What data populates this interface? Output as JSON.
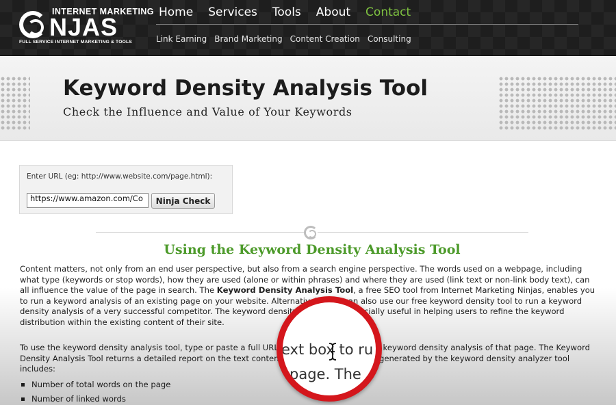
{
  "header": {
    "logo": {
      "top_text": "INTERNET MARKETING",
      "main_text": "NJAS",
      "sub_text": "FULL SERVICE INTERNET MARKETING & TOOLS"
    },
    "main_nav": [
      {
        "label": "Home"
      },
      {
        "label": "Services"
      },
      {
        "label": "Tools"
      },
      {
        "label": "About"
      },
      {
        "label": "Contact"
      }
    ],
    "sub_nav": [
      {
        "label": "Link Earning"
      },
      {
        "label": "Brand Marketing"
      },
      {
        "label": "Content Creation"
      },
      {
        "label": "Consulting"
      }
    ],
    "active_color": "#7fc241"
  },
  "banner": {
    "title": "Keyword Density Analysis Tool",
    "subtitle": "Check the Influence and Value of Your Keywords"
  },
  "url_form": {
    "label": "Enter URL (eg: http://www.website.com/page.html):",
    "value": "https://www.amazon.com/Co",
    "button_label": "Ninja Check"
  },
  "section": {
    "title": "Using the Keyword Density Analysis Tool",
    "title_color": "#4c9a2a",
    "para1_part1": "Content matters, not only from an end user perspective, but also from a search engine perspective. The words used on a webpage, including what type (keywords or stop words), how they are used (alone or within phrases) and where they are used (link text or non-link body text), can all influence the value of the page in search. The ",
    "para1_bold": "Keyword Density Analysis Tool",
    "para1_part2": ", a free SEO tool from Internet Marketing Ninjas, enables you to run a keyword analysis of an existing page on your website. Alternatively, you can also use our free keyword density tool to run a keyword density analysis of a very successful competitor. The keyword density analyzer is especially useful in helping users to refine the keyword distribution within the existing content of their site.",
    "para2": "To use the keyword density analysis tool, type or paste a full URL into the text box to run a keyword density analysis of that page. The Keyword Density Analysis Tool returns a detailed report on the text content of the page. The report generated by the keyword density analyzer tool includes:",
    "list": [
      "Number of total words on the page",
      "Number of linked words"
    ]
  },
  "magnifier": {
    "line1": "ext box to",
    "line1_tail": "ru",
    "line2": "page. The",
    "ring_color": "#d4161c"
  }
}
